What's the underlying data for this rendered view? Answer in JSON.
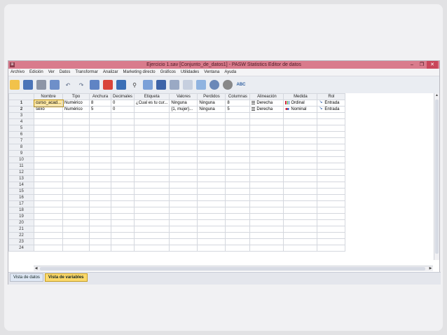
{
  "window": {
    "title": "Ejercicio 1.sav [Conjunto_de_datos1] - PASW Statistics Editor de datos",
    "app_icon": "spss-icon",
    "controls": [
      "–",
      "❐",
      "✕"
    ]
  },
  "menu": [
    "Archivo",
    "Edición",
    "Ver",
    "Datos",
    "Transformar",
    "Analizar",
    "Marketing directo",
    "Gráficos",
    "Utilidades",
    "Ventana",
    "Ayuda"
  ],
  "toolbar": {
    "icons": [
      "open-icon",
      "save-icon",
      "print-icon",
      "dialog-recall-icon",
      "undo-icon",
      "redo-icon",
      "goto-case-icon",
      "goto-variable-icon",
      "variables-icon",
      "find-icon",
      "insert-cases-icon",
      "insert-variable-icon",
      "split-file-icon",
      "weight-cases-icon",
      "select-cases-icon",
      "value-labels-icon",
      "use-sets-icon",
      "spelling-icon"
    ],
    "spell_label": "ABC"
  },
  "grid": {
    "columns": [
      "Nombre",
      "Tipo",
      "Anchura",
      "Decimales",
      "Etiqueta",
      "Valores",
      "Perdidos",
      "Columnas",
      "Alineación",
      "Medida",
      "Rol"
    ],
    "rows": [
      {
        "n": "1",
        "nombre": "curso_acad...",
        "tipo": "Numérico",
        "anchura": "8",
        "decimales": "0",
        "etiqueta": "¿Cual es tu cur...",
        "valores": "Ninguna",
        "perdidos": "Ninguna",
        "columnas": "8",
        "alineacion": "Derecha",
        "medida": "Ordinal",
        "rol": "Entrada"
      },
      {
        "n": "2",
        "nombre": "sexo",
        "tipo": "Numérico",
        "anchura": "5",
        "decimales": "0",
        "etiqueta": "",
        "valores": "{1, mujer}...",
        "perdidos": "Ninguna",
        "columnas": "5",
        "alineacion": "Derecha",
        "medida": "Nominal",
        "rol": "Entrada"
      }
    ],
    "empty_rows": [
      "3",
      "4",
      "5",
      "6",
      "7",
      "8",
      "9",
      "10",
      "11",
      "12",
      "13",
      "14",
      "15",
      "16",
      "17",
      "18",
      "19",
      "20",
      "21",
      "22",
      "23",
      "24"
    ]
  },
  "tabs": [
    "Vista de datos",
    "Vista de variables"
  ],
  "active_tab": "Vista de variables"
}
